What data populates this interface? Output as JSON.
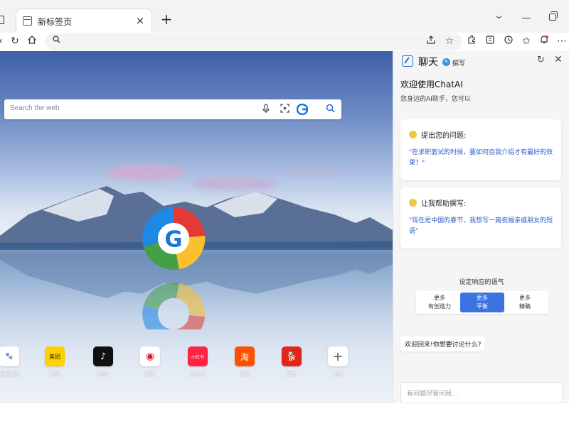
{
  "browser": {
    "tab_title": "新标签页",
    "tab_close": "×",
    "new_tab": "+",
    "icons": [
      "tab-icon",
      "close-icon",
      "plus-icon",
      "chevron-down-icon",
      "minimize-icon",
      "restore-icon",
      "back-icon",
      "refresh-icon",
      "home-icon",
      "search-icon",
      "share-icon",
      "star-icon",
      "extensions-icon",
      "profile-icon",
      "history-icon",
      "favorites-icon",
      "notifications-icon",
      "more-icon"
    ]
  },
  "newtab": {
    "search_placeholder": "Search the web",
    "shortcuts": [
      {
        "label": "百度搜索",
        "tile": "🐾",
        "color": "#2b62e3"
      },
      {
        "label": "美团",
        "tile": "美团",
        "color": "#ffd100"
      },
      {
        "label": "抖音",
        "tile": "♪",
        "color": "#111111"
      },
      {
        "label": "微博",
        "tile": "◉",
        "color": "#e6162d"
      },
      {
        "label": "小红书",
        "tile": "小红书",
        "color": "#ff2442"
      },
      {
        "label": "淘宝",
        "tile": "淘",
        "color": "#ff5000"
      },
      {
        "label": "京东",
        "tile": "🐕",
        "color": "#e1251b"
      },
      {
        "label": "更多",
        "tile": "+",
        "color": "#555555"
      }
    ]
  },
  "chat": {
    "title": "聊天",
    "compose": "撰写",
    "welcome": "欢迎使用ChatAI",
    "welcome_sub": "您身边的AI助手，您可以",
    "card1": {
      "head": "提出您的问题:",
      "body": "\"在求职面试的时候，要如何自我介绍才有最好的效果？\""
    },
    "card2": {
      "head": "让我帮助撰写:",
      "body": "\"现在是中国的春节，我想写一篇祝福亲戚朋友的短语\""
    },
    "tone_label": "设定响应的语气",
    "tones": [
      {
        "line1": "更多",
        "line2": "有创造力"
      },
      {
        "line1": "更多",
        "line2": "平衡"
      },
      {
        "line1": "更多",
        "line2": "精确"
      }
    ],
    "bot_message": "欢迎回来!你想要讨论什么?",
    "input_placeholder": "有问题尽管问我..."
  },
  "colors": {
    "accent": "#3b73e0",
    "link_blue": "#2f5fc4"
  }
}
